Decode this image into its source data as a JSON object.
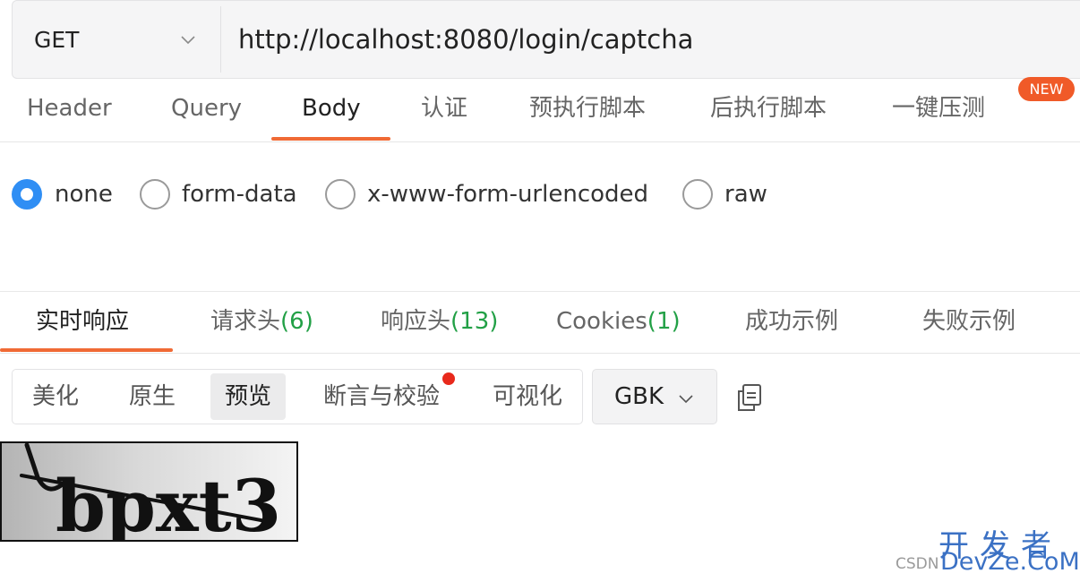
{
  "request": {
    "method": "GET",
    "url": "http://localhost:8080/login/captcha"
  },
  "request_tabs": {
    "items": [
      "Header",
      "Query",
      "Body",
      "认证",
      "预执行脚本",
      "后执行脚本",
      "一键压测"
    ],
    "active": "Body",
    "new_badge": "NEW"
  },
  "body_options": {
    "items": [
      "none",
      "form-data",
      "x-www-form-urlencoded",
      "raw"
    ],
    "selected": "none"
  },
  "response_tabs": {
    "realtime": "实时响应",
    "req_headers": {
      "label": "请求头",
      "count": "(6)"
    },
    "resp_headers": {
      "label": "响应头",
      "count": "(13)"
    },
    "cookies": {
      "label": "Cookies",
      "count": "(1)"
    },
    "success_example": "成功示例",
    "fail_example": "失败示例",
    "active": "实时响应"
  },
  "view_modes": {
    "items": [
      "美化",
      "原生",
      "预览",
      "断言与校验",
      "可视化"
    ],
    "active": "预览"
  },
  "encoding": "GBK",
  "captcha": {
    "text": "bpxt3"
  },
  "watermark": {
    "cn": "开发者",
    "en": "DevZe.CoM",
    "csdn": "CSDN"
  },
  "colors": {
    "accent": "#f06a35",
    "radio_selected": "#2f8ef4",
    "count_green": "#22a046",
    "badge": "#f05a28",
    "watermark": "#3b71c4"
  },
  "icons": {
    "method_dropdown": "chevron-down-icon",
    "encoding_dropdown": "chevron-down-icon",
    "copy": "copy-icon"
  }
}
